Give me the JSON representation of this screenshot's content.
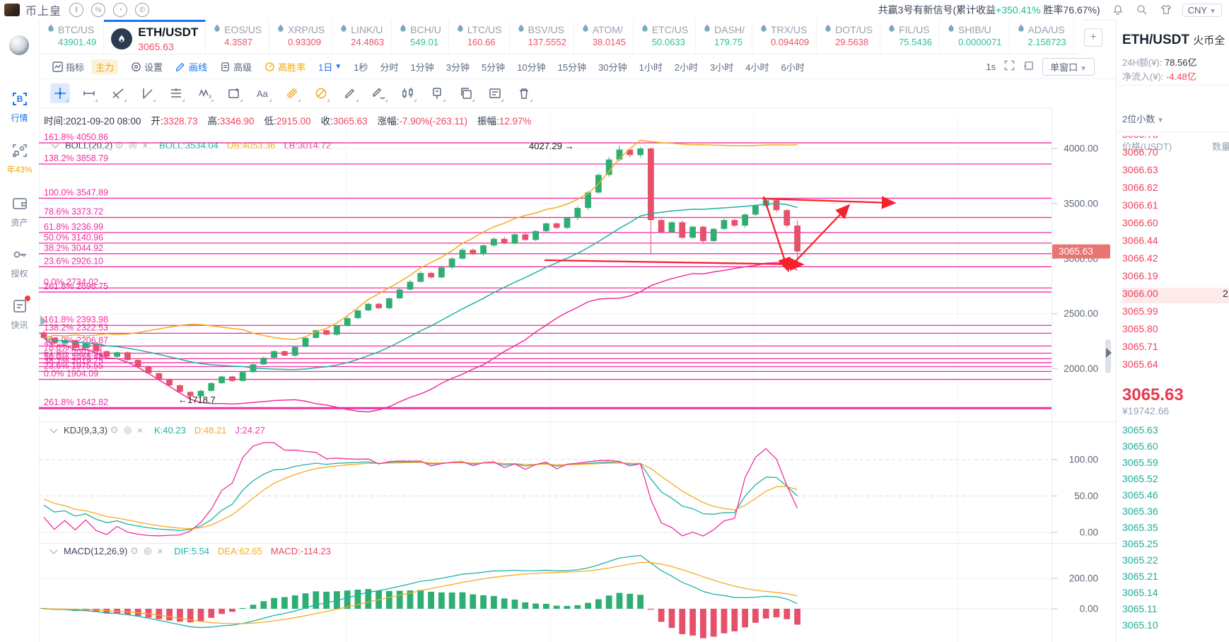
{
  "topbar": {
    "app_name": "币上皇",
    "signal_text": "共赢3号有新信号(累计收益",
    "signal_gain": "+350.41%",
    "signal_rate": " 胜率76.67%)",
    "currency": "CNY"
  },
  "sidebar": {
    "items": [
      {
        "name": "market",
        "label": "行情",
        "active": true
      },
      {
        "name": "yearly",
        "label": "年43%",
        "orange": true
      },
      {
        "name": "assets",
        "label": "资产"
      },
      {
        "name": "auth",
        "label": "授权"
      },
      {
        "name": "news",
        "label": "快讯",
        "dot": true
      }
    ]
  },
  "tickers": [
    {
      "symbol": "BTC/US",
      "value": "43901.49",
      "dir": "up"
    },
    {
      "symbol": "ETH/USDT",
      "value": "3065.63",
      "dir": "down",
      "active": true
    },
    {
      "symbol": "EOS/US",
      "value": "4.3587",
      "dir": "down"
    },
    {
      "symbol": "XRP/US",
      "value": "0.93309",
      "dir": "down"
    },
    {
      "symbol": "LINK/U",
      "value": "24.4863",
      "dir": "down"
    },
    {
      "symbol": "BCH/U",
      "value": "549.01",
      "dir": "up"
    },
    {
      "symbol": "LTC/US",
      "value": "160.66",
      "dir": "down"
    },
    {
      "symbol": "BSV/US",
      "value": "137.5552",
      "dir": "down"
    },
    {
      "symbol": "ATOM/",
      "value": "38.0145",
      "dir": "down"
    },
    {
      "symbol": "ETC/US",
      "value": "50.0633",
      "dir": "up"
    },
    {
      "symbol": "DASH/",
      "value": "179.75",
      "dir": "up"
    },
    {
      "symbol": "TRX/US",
      "value": "0.094409",
      "dir": "down"
    },
    {
      "symbol": "DOT/US",
      "value": "29.5638",
      "dir": "down"
    },
    {
      "symbol": "FIL/US",
      "value": "75.5436",
      "dir": "up"
    },
    {
      "symbol": "SHIB/U",
      "value": "0.0000071",
      "dir": "up"
    },
    {
      "symbol": "ADA/US",
      "value": "2.158723",
      "dir": "up"
    }
  ],
  "toolbar": {
    "indicator": "指标",
    "main_force": "主力",
    "settings": "设置",
    "draw": "画线",
    "advanced": "高级",
    "winrate": "高胜率",
    "interval_selected": "1日",
    "intervals": [
      "1秒",
      "分时",
      "1分钟",
      "3分钟",
      "5分钟",
      "10分钟",
      "15分钟",
      "30分钟",
      "1小时",
      "2小时",
      "3小时",
      "4小时",
      "6小时"
    ],
    "right_label": "1s",
    "window_btn": "单窗口"
  },
  "draw_tools": [
    "crosshair",
    "horizontal-segment",
    "trend-line",
    "angle-line",
    "parallel-channel",
    "wave-pattern",
    "rectangle-tool",
    "text-tool",
    "fib-retracement",
    "fib-circle",
    "brush",
    "freehand",
    "candle-pattern",
    "pin-tool",
    "copy-tool",
    "note-tool",
    "delete-tool"
  ],
  "info_bar": {
    "fields": [
      {
        "label": "时间:",
        "value": "2021-09-20 08:00",
        "dark": true
      },
      {
        "label": "开:",
        "value": "3328.73"
      },
      {
        "label": "高:",
        "value": "3346.90"
      },
      {
        "label": "低:",
        "value": "2915.00"
      },
      {
        "label": "收:",
        "value": "3065.63"
      },
      {
        "label": "涨幅:",
        "value": "-7.90%(-263.11)"
      },
      {
        "label": "振幅:",
        "value": "12.97%"
      }
    ]
  },
  "legends": {
    "boll": {
      "name": "BOLL(20,2)",
      "items": [
        {
          "t": "BOLL:3534.04",
          "c": "teal"
        },
        {
          "t": "UB:4053.36",
          "c": "orange"
        },
        {
          "t": "LB:3014.72",
          "c": "pink"
        }
      ]
    },
    "kdj": {
      "name": "KDJ(9,3,3)",
      "items": [
        {
          "t": "K:40.23",
          "c": "teal"
        },
        {
          "t": "D:48.21",
          "c": "orange"
        },
        {
          "t": "J:24.27",
          "c": "pink"
        }
      ]
    },
    "macd": {
      "name": "MACD(12,26,9)",
      "items": [
        {
          "t": "DIF:5.54",
          "c": "teal"
        },
        {
          "t": "DEA:62.65",
          "c": "orange"
        },
        {
          "t": "MACD:-114.23",
          "c": "red"
        }
      ]
    }
  },
  "order_book": {
    "title": "ETH/USDT",
    "exchange": "火币全",
    "h24_label": "24H额(¥):",
    "h24": "78.56亿",
    "flow_label": "净流入(¥):",
    "flow": "-4.48亿",
    "decimals": "2位小数",
    "col_price": "价格(USDT)",
    "col_amount": "数量",
    "asks": [
      "3066.73",
      "3066.70",
      "3066.63",
      "3066.62",
      "3066.61",
      "3066.60",
      "3066.44",
      "3066.42",
      "3066.19",
      "3066.00",
      "3065.99",
      "3065.80",
      "3065.71",
      "3065.64"
    ],
    "highlight_index": 9,
    "highlight_amount": "2",
    "last": "3065.63",
    "last_cny": "¥19742.66",
    "bids": [
      "3065.63",
      "3065.60",
      "3065.59",
      "3065.52",
      "3065.46",
      "3065.36",
      "3065.35",
      "3065.25",
      "3065.22",
      "3065.21",
      "3065.14",
      "3065.11",
      "3065.10"
    ]
  },
  "colors": {
    "accent_blue": "#1a74f2",
    "up_green": "#2fae74",
    "down_red": "#e7506a",
    "pink": "#ef2f9f",
    "orange": "#f7aa1f",
    "teal": "#1db2a5",
    "book_red": "#f0425e",
    "book_green": "#1fae93",
    "tag_red": "#e97572",
    "annotation_red": "#f5222d",
    "grid": "#f0f1f4",
    "axis_text": "#5a6678"
  },
  "chart_data": {
    "type": "candlestick",
    "symbol": "ETH/USDT",
    "interval": "1日",
    "ohlc_displayed": {
      "open": 3328.73,
      "high": 3346.9,
      "low": 2915.0,
      "close": 3065.63
    },
    "closes": [
      2280,
      2230,
      2260,
      2190,
      2230,
      2160,
      2110,
      2150,
      2080,
      2020,
      1960,
      1900,
      1850,
      1790,
      1750,
      1800,
      1870,
      1930,
      1890,
      1970,
      2040,
      2100,
      2160,
      2120,
      2200,
      2280,
      2350,
      2310,
      2390,
      2460,
      2530,
      2590,
      2550,
      2640,
      2720,
      2790,
      2870,
      2830,
      2920,
      3000,
      3080,
      3040,
      3120,
      3180,
      3140,
      3220,
      3170,
      3250,
      3320,
      3280,
      3370,
      3460,
      3600,
      3760,
      3900,
      3990,
      3940,
      4000,
      3350,
      3240,
      3330,
      3190,
      3290,
      3160,
      3270,
      3350,
      3300,
      3400,
      3480,
      3530,
      3440,
      3300,
      3065.63
    ],
    "first_open": 2330,
    "overrides": {
      "14": {
        "low": 1718.7
      },
      "55": {
        "high": 4027.29
      },
      "58": {
        "low": 3042
      },
      "72": {
        "low": 2915,
        "high": 3346.9
      }
    },
    "price_ticks": [
      {
        "label": "4000.00",
        "price": 4000
      },
      {
        "label": "3500.00",
        "price": 3500
      },
      {
        "label": "3000.00",
        "price": 3000
      },
      {
        "label": "2500.00",
        "price": 2500
      },
      {
        "label": "2000.00",
        "price": 2000
      }
    ],
    "price_tag": "3065.63",
    "price_tag_value": 3065.63,
    "kdj_ticks": [
      {
        "label": "100.00",
        "v": 100
      },
      {
        "label": "50.00",
        "v": 50
      },
      {
        "label": "0.00",
        "v": 0
      }
    ],
    "macd_ticks": [
      {
        "label": "200.00",
        "v": 200
      },
      {
        "label": "0.00",
        "v": 0
      }
    ],
    "fib_levels": [
      {
        "label": "161.8% 4050.86",
        "price": 4050.86
      },
      {
        "label": "138.2% 3858.79",
        "price": 3858.79
      },
      {
        "label": "100.0% 3547.89",
        "price": 3547.89
      },
      {
        "label": "78.6% 3373.72",
        "price": 3373.72
      },
      {
        "label": "61.8% 3236.99",
        "price": 3236.99
      },
      {
        "label": "50.0% 3140.96",
        "price": 3140.96
      },
      {
        "label": "38.2% 3044.92",
        "price": 3044.92
      },
      {
        "label": "23.6% 2926.10",
        "price": 2926.1
      },
      {
        "label": "0.0% 2734.02",
        "price": 2734.02
      },
      {
        "label": "261.8% 2696.75",
        "price": 2696.75
      },
      {
        "label": "161.8% 2393.98",
        "price": 2393.98
      },
      {
        "label": "138.2% 2322.53",
        "price": 2322.53
      },
      {
        "label": "100.0% 2206.87",
        "price": 2206.87
      },
      {
        "label": "78.6% 2142.07",
        "price": 2142.07
      },
      {
        "label": "61.8% 2091.21",
        "price": 2091.21
      },
      {
        "label": "50.0% 2055.48",
        "price": 2055.48
      },
      {
        "label": "38.2% 2019.75",
        "price": 2019.75
      },
      {
        "label": "23.6% 1975.55",
        "price": 1975.55
      },
      {
        "label": "0.0% 1904.09",
        "price": 1904.09
      },
      {
        "label": "261.8% 1642.82",
        "price": 1642.82,
        "thick": true
      }
    ],
    "annotations": {
      "peak_label": "4027.29 →",
      "low_label": "←1718.7"
    }
  }
}
